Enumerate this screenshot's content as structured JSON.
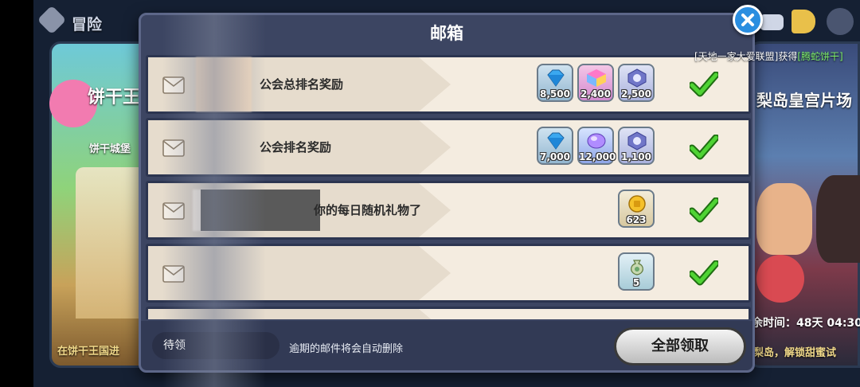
{
  "background": {
    "top_left_label": "冒险",
    "left_banner_title": "饼干王",
    "left_banner_sub": "饼干城堡",
    "left_bottom_text": "在饼干王国进",
    "right_banner_title": "梨岛皇宫片场",
    "right_timer": "余时间：48天 04:30",
    "right_bottom_text": "梨岛，解锁甜蜜试"
  },
  "modal": {
    "title": "邮箱",
    "broadcast_prefix": "[天地一家大爱联盟]获得",
    "broadcast_highlight": "[腾蛇饼干]",
    "mails": [
      {
        "title": "公会总排名奖励",
        "rewards": [
          {
            "icon": "diamond-icon",
            "count": "8,500"
          },
          {
            "icon": "rainbow-cube-icon",
            "count": "2,400"
          },
          {
            "icon": "gear-token-icon",
            "count": "2,500"
          }
        ]
      },
      {
        "title": "公会排名奖励",
        "rewards": [
          {
            "icon": "diamond-icon",
            "count": "7,000"
          },
          {
            "icon": "crystal-icon",
            "count": "12,000"
          },
          {
            "icon": "gear-token-icon",
            "count": "1,100"
          }
        ]
      },
      {
        "title": "你的每日随机礼物了",
        "rewards": [
          {
            "icon": "gold-coin-icon",
            "count": "623"
          }
        ]
      },
      {
        "title": "",
        "rewards": [
          {
            "icon": "money-bag-icon",
            "count": "5"
          }
        ]
      }
    ],
    "footer": {
      "pending_label": "待领",
      "note": "逾期的邮件将会自动删除",
      "claim_all_label": "全部领取"
    }
  },
  "colors": {
    "modal_bg": "#3c4562",
    "row_bg": "#f4ece0",
    "check_green": "#3fbf2a",
    "close_blue": "#2a8ee0"
  }
}
